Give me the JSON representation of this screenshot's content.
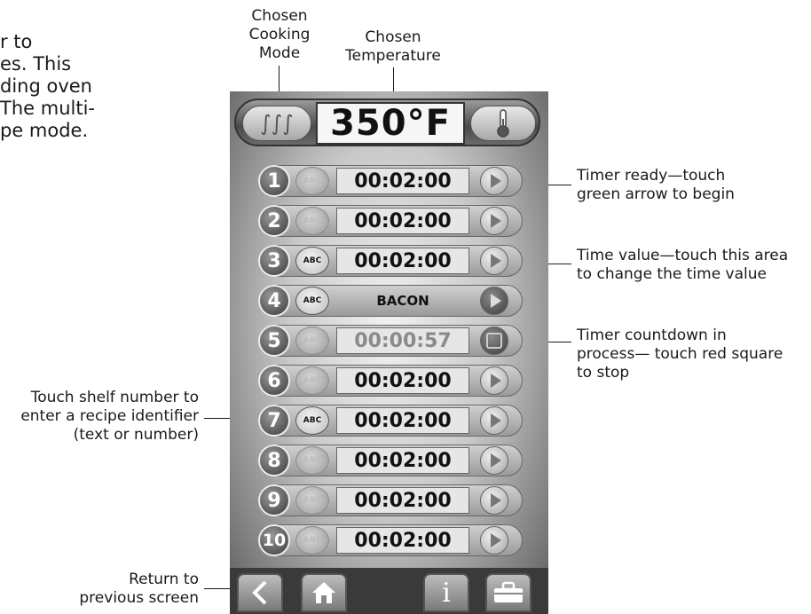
{
  "intro_text": {
    "line1": "r to",
    "line2": "es. This",
    "line3": "ding oven",
    "line4": "The multi-",
    "line5": "pe mode."
  },
  "annotations": {
    "cooking_mode": [
      "Chosen",
      "Cooking",
      "Mode"
    ],
    "temperature": [
      "Chosen",
      "Temperature"
    ],
    "timer_ready": [
      "Timer ready—touch",
      "green arrow to begin"
    ],
    "time_value": [
      "Time value—touch this area",
      "to change the time value"
    ],
    "countdown": [
      "Timer countdown in",
      "process— touch red square",
      "to stop"
    ],
    "shelf_number": [
      "Touch shelf number to",
      "enter a recipe identifier",
      "(text or number)"
    ],
    "return": [
      "Return to",
      "previous screen"
    ]
  },
  "device": {
    "temperature": "350°F",
    "mode_icon": "steam-icon",
    "thermometer_icon": "thermometer-icon",
    "rows": [
      {
        "shelf": "1",
        "abc": "ABC",
        "abc_active": false,
        "time": "00:02:00",
        "state": "ready"
      },
      {
        "shelf": "2",
        "abc": "ABC",
        "abc_active": false,
        "time": "00:02:00",
        "state": "ready"
      },
      {
        "shelf": "3",
        "abc": "ABC",
        "abc_active": true,
        "time": "00:02:00",
        "state": "ready"
      },
      {
        "shelf": "4",
        "abc": "ABC",
        "abc_active": true,
        "time": "BACON",
        "state": "label"
      },
      {
        "shelf": "5",
        "abc": "ABC",
        "abc_active": false,
        "time": "00:00:57",
        "state": "countdown"
      },
      {
        "shelf": "6",
        "abc": "ABC",
        "abc_active": false,
        "time": "00:02:00",
        "state": "ready"
      },
      {
        "shelf": "7",
        "abc": "ABC",
        "abc_active": true,
        "time": "00:02:00",
        "state": "ready"
      },
      {
        "shelf": "8",
        "abc": "ABC",
        "abc_active": false,
        "time": "00:02:00",
        "state": "ready"
      },
      {
        "shelf": "9",
        "abc": "ABC",
        "abc_active": false,
        "time": "00:02:00",
        "state": "ready"
      },
      {
        "shelf": "10",
        "abc": "ABC",
        "abc_active": false,
        "time": "00:02:00",
        "state": "ready"
      }
    ],
    "bottom_buttons": [
      "back-arrow-icon",
      "home-icon",
      "info-icon",
      "toolbox-icon"
    ],
    "info_glyph": "i"
  }
}
